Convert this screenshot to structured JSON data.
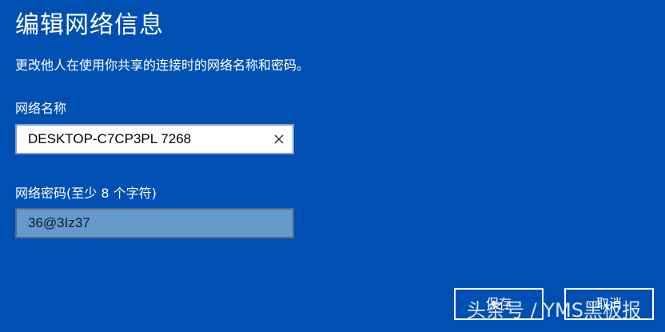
{
  "dialog": {
    "title": "编辑网络信息",
    "description": "更改他人在使用你共享的连接时的网络名称和密码。",
    "network_name": {
      "label": "网络名称",
      "value": "DESKTOP-C7CP3PL 7268"
    },
    "network_password": {
      "label": "网络密码(至少 8 个字符)",
      "value": "36@3Iz37"
    },
    "buttons": {
      "save": "保存",
      "cancel": "取消"
    }
  },
  "watermark": "头条号 / YMS黑板报",
  "colors": {
    "background": "#0050b3",
    "text": "#ffffff",
    "password_field_bg": "#6699cc"
  }
}
